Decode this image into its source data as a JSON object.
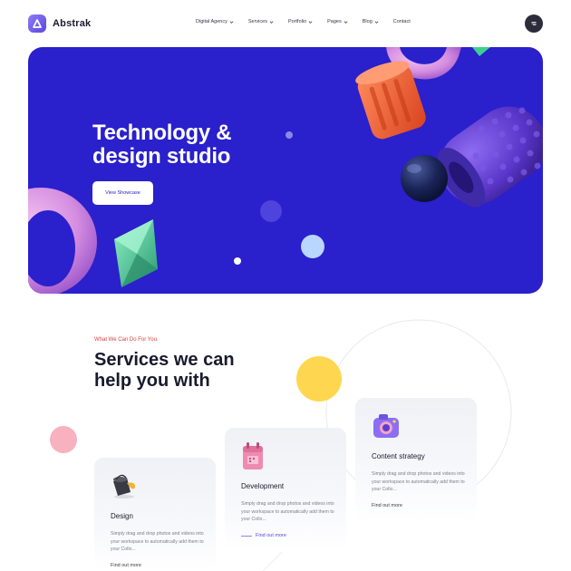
{
  "brand": {
    "name": "Abstrak",
    "accent": "#2a20cc"
  },
  "nav": {
    "items": [
      {
        "label": "Digital Agency",
        "has_dropdown": true
      },
      {
        "label": "Services",
        "has_dropdown": true
      },
      {
        "label": "Portfolio",
        "has_dropdown": true
      },
      {
        "label": "Pages",
        "has_dropdown": true
      },
      {
        "label": "Blog",
        "has_dropdown": true
      },
      {
        "label": "Contact",
        "has_dropdown": false
      }
    ],
    "menu_icon": "menu-icon"
  },
  "hero": {
    "title_line1": "Technology &",
    "title_line2": "design studio",
    "button_label": "View Showcase",
    "background": "#2a20cc"
  },
  "services": {
    "eyebrow": "What We Can Do For You.",
    "title_line1": "Services we can",
    "title_line2": "help you with",
    "cards": [
      {
        "icon": "paint-bucket-icon",
        "title": "Design",
        "text": "Simply drag and drop photos and videos into your workspace to automatically add them to your Collo...",
        "link": "Find out more"
      },
      {
        "icon": "calendar-icon",
        "title": "Development",
        "text": "Simply drag and drop photos and videos into your workspace to automatically add them to your Collo...",
        "link": "Find out more"
      },
      {
        "icon": "camera-icon",
        "title": "Content strategy",
        "text": "Simply drag and drop photos and videos into your workspace to automatically add them to your Collo...",
        "link": "Find out more"
      }
    ]
  }
}
